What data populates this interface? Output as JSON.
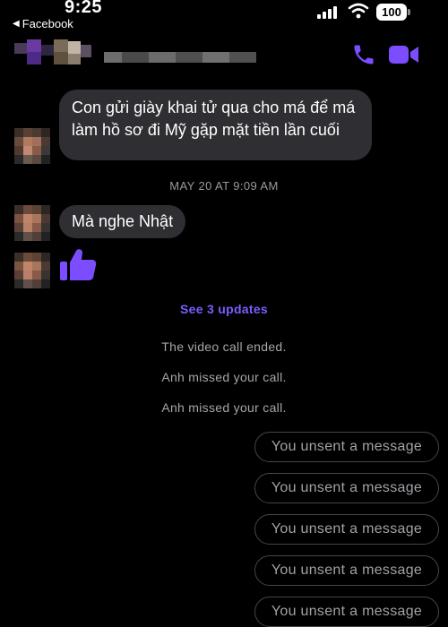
{
  "status_bar": {
    "time": "9:25",
    "back_app": "Facebook",
    "battery": "100"
  },
  "header": {
    "contact_name": "",
    "call_icon": "phone-icon",
    "video_icon": "video-camera-icon",
    "accent_color": "#7b4dff"
  },
  "messages": {
    "m1": "Con gửi giày khai tử qua cho má để má làm hồ sơ đi Mỹ gặp mặt tiền lần cuối",
    "timestamp": "MAY 20 AT 9:09 AM",
    "m2": "Mà nghe Nhật",
    "like_icon": "thumbs-up-icon"
  },
  "updates": {
    "see_updates": "See 3 updates",
    "events": [
      "The video call ended.",
      "Anh missed your call.",
      "Anh missed your call."
    ]
  },
  "unsent": [
    "You unsent a message",
    "You unsent a message",
    "You unsent a message",
    "You unsent a message",
    "You unsent a message"
  ]
}
